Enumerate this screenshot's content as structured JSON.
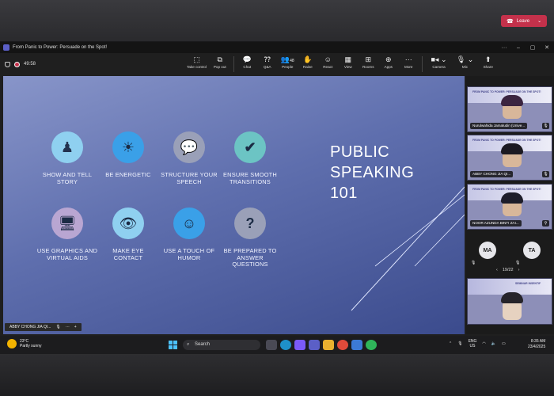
{
  "window": {
    "title": "From Panic to Power: Persuade on the Spot!"
  },
  "meeting": {
    "elapsed": "49:58"
  },
  "toolbar": {
    "items": [
      {
        "label": "Take control",
        "icon": "take-control-icon"
      },
      {
        "label": "Pop out",
        "icon": "pop-out-icon"
      },
      {
        "label": "Chat",
        "icon": "chat-icon"
      },
      {
        "label": "Q&A",
        "icon": "qa-icon"
      },
      {
        "label": "People",
        "icon": "people-icon",
        "count": "48"
      },
      {
        "label": "Raise",
        "icon": "raise-hand-icon"
      },
      {
        "label": "React",
        "icon": "react-icon"
      },
      {
        "label": "View",
        "icon": "view-icon"
      },
      {
        "label": "Rooms",
        "icon": "rooms-icon"
      },
      {
        "label": "Apps",
        "icon": "apps-icon"
      },
      {
        "label": "More",
        "icon": "more-icon"
      }
    ],
    "camera": "Camera",
    "mic": "Mic",
    "share": "Share",
    "leave": "Leave"
  },
  "slide": {
    "title_lines": [
      "PUBLIC",
      "SPEAKING",
      "101"
    ],
    "tips": [
      {
        "label": "SHOW AND TELL STORY",
        "icon": "person-podium-icon",
        "color": "#8fd0f0"
      },
      {
        "label": "BE ENERGETIC",
        "icon": "sun-icon",
        "color": "#3aa0e8"
      },
      {
        "label": "STRUCTURE YOUR SPEECH",
        "icon": "speech-bubbles-icon",
        "color": "#9aa0b8"
      },
      {
        "label": "ENSURE SMOOTH TRANSITIONS",
        "icon": "checkmark-icon",
        "color": "#6cc4c4"
      },
      {
        "label": "USE GRAPHICS AND VIRTUAL AIDS",
        "icon": "monitor-icon",
        "color": "#b9a6d2"
      },
      {
        "label": "MAKE EYE CONTACT",
        "icon": "eye-icon",
        "color": "#8fd0f0"
      },
      {
        "label": "USE A TOUCH OF HUMOR",
        "icon": "smiley-icon",
        "color": "#3aa0e8"
      },
      {
        "label": "BE PREPARED TO ANSWER QUESTIONS",
        "icon": "question-icon",
        "color": "#9aa0b8"
      }
    ],
    "presenter_name": "ABBY CHONG JIA QI..."
  },
  "participants": {
    "tiles": [
      {
        "name": "Nurulwahida Jamaludin (Unive...",
        "banner": "FROM PANIC TO POWER: PERSUADE ON THE SPOT!"
      },
      {
        "name": "ABBY CHONG JIA QI...",
        "banner": "FROM PANIC TO POWER: PERSUADE ON THE SPOT!"
      },
      {
        "name": "NOOR AZUNDA BINTI ZAI...",
        "banner": "FROM PANIC TO POWER: PERSUADE ON THE SPOT!"
      },
      {
        "name": "",
        "banner": "SEMINAR INSENTIF"
      }
    ],
    "avatars": [
      "MA",
      "TA"
    ],
    "pager": "19/22"
  },
  "taskbar": {
    "weather_temp": "23°C",
    "weather_desc": "Partly sunny",
    "search_placeholder": "Search",
    "lang": "ENG",
    "region": "US",
    "time": "8:35 AM",
    "date": "23/4/2025"
  }
}
